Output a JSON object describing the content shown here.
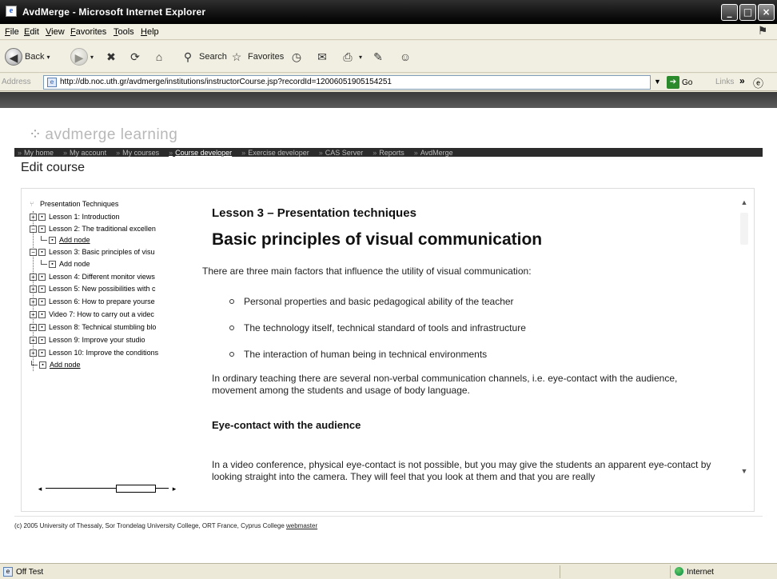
{
  "window": {
    "title": "AvdMerge - Microsoft Internet Explorer",
    "controls": {
      "minimize": "_",
      "maximize": "□",
      "close": "×"
    }
  },
  "menu": [
    "File",
    "Edit",
    "View",
    "Favorites",
    "Tools",
    "Help"
  ],
  "toolbar": {
    "back": "Back",
    "search": "Search",
    "favorites": "Favorites"
  },
  "address": {
    "label": "Address",
    "url": "http://db.noc.uth.gr/avdmerge/institutions/instructorCourse.jsp?recordId=12006051905154251",
    "go": "Go",
    "links": "Links"
  },
  "site": {
    "logo": "avdmerge learning",
    "nav": [
      {
        "label": "My home"
      },
      {
        "label": "My account"
      },
      {
        "label": "My courses"
      },
      {
        "label": "Course developer",
        "active": true
      },
      {
        "label": "Exercise developer"
      },
      {
        "label": "CAS Server"
      },
      {
        "label": "Reports"
      },
      {
        "label": "AvdMerge"
      }
    ],
    "page_title": "Edit course"
  },
  "tree": {
    "root": "Presentation Techniques",
    "items": [
      {
        "label": "Lesson 1: Introduction",
        "type": "lesson"
      },
      {
        "label": "Lesson 2: The traditional excellen",
        "type": "lesson"
      },
      {
        "label": "Add node",
        "type": "add",
        "underline": true
      },
      {
        "label": "Lesson 3: Basic principles of visu",
        "type": "lesson"
      },
      {
        "label": "Add node",
        "type": "add",
        "underline": false
      },
      {
        "label": "Lesson 4: Different monitor views",
        "type": "lesson"
      },
      {
        "label": "Lesson 5: New possibilities with c",
        "type": "lesson"
      },
      {
        "label": "Lesson 6: How to prepare yourse",
        "type": "lesson"
      },
      {
        "label": "Video 7: How to carry out a videc",
        "type": "lesson"
      },
      {
        "label": "Lesson 8: Technical stumbling blo",
        "type": "lesson"
      },
      {
        "label": "Lesson 9: Improve your studio",
        "type": "lesson"
      },
      {
        "label": "Lesson 10: Improve the conditions",
        "type": "lesson"
      },
      {
        "label": "Add node",
        "type": "add",
        "underline": true
      }
    ]
  },
  "lesson": {
    "eyebrow": "Lesson 3 – Presentation techniques",
    "heading": "Basic principles of visual communication",
    "intro": "There are three main factors that influence the utility of visual communication:",
    "bullets": [
      "Personal properties and basic pedagogical ability of the teacher",
      "The technology itself, technical standard of tools and infrastructure",
      "The interaction of human being in technical environments"
    ],
    "paragraph": "In ordinary teaching there are several non-verbal communication channels, i.e. eye-contact with the audience, movement among the students and usage of body language.",
    "subheading": "Eye-contact with the audience",
    "paragraph2": "In a video conference, physical eye-contact is not possible, but you may give the students an apparent eye-contact by looking straight into the camera. They will feel that you look at them and that you are really"
  },
  "footer": {
    "text": "(c) 2005 University of Thessaly, Sor Trondelag University College, ORT France, Cyprus College ",
    "link": "webmaster"
  },
  "status": {
    "text": "Off Test",
    "zone": "Internet"
  }
}
